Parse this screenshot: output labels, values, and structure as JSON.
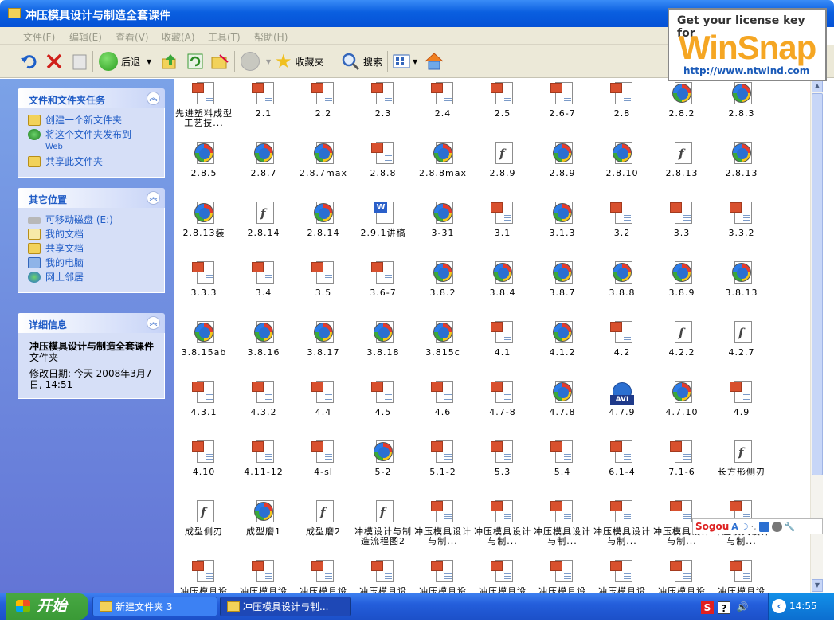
{
  "window": {
    "title": "冲压模具设计与制造全套课件"
  },
  "menu": [
    "文件(F)",
    "编辑(E)",
    "查看(V)",
    "收藏(A)",
    "工具(T)",
    "帮助(H)"
  ],
  "toolbar": {
    "back_label": "后退",
    "favorites_label": "收藏夹",
    "search_label": "搜索"
  },
  "watermark": {
    "line1": "Get your license key for",
    "brand": "WinSnap",
    "url": "http://www.ntwind.com"
  },
  "sidebar": {
    "tasks": {
      "title": "文件和文件夹任务",
      "items": [
        "创建一个新文件夹",
        "将这个文件夹发布到",
        "Web",
        "共享此文件夹"
      ]
    },
    "places": {
      "title": "其它位置",
      "items": [
        "可移动磁盘 (E:)",
        "我的文档",
        "共享文档",
        "我的电脑",
        "网上邻居"
      ]
    },
    "details": {
      "title": "详细信息",
      "name": "冲压模具设计与制造全套课件",
      "type": "文件夹",
      "modified": "修改日期: 今天 2008年3月7日, 14:51"
    }
  },
  "files": [
    {
      "name": "先进塑料成型工艺技...",
      "type": "ppt"
    },
    {
      "name": "2.1",
      "type": "ppt"
    },
    {
      "name": "2.2",
      "type": "ppt"
    },
    {
      "name": "2.3",
      "type": "ppt"
    },
    {
      "name": "2.4",
      "type": "ppt"
    },
    {
      "name": "2.5",
      "type": "ppt"
    },
    {
      "name": "2.6-7",
      "type": "ppt"
    },
    {
      "name": "2.8",
      "type": "ppt"
    },
    {
      "name": "2.8.2",
      "type": "wmv"
    },
    {
      "name": "2.8.3",
      "type": "wmv"
    },
    {
      "name": "2.8.5",
      "type": "wmv"
    },
    {
      "name": "2.8.7",
      "type": "wmv"
    },
    {
      "name": "2.8.7max",
      "type": "wmv"
    },
    {
      "name": "2.8.8",
      "type": "ppt"
    },
    {
      "name": "2.8.8max",
      "type": "wmv"
    },
    {
      "name": "2.8.9",
      "type": "swf"
    },
    {
      "name": "2.8.9",
      "type": "wmv"
    },
    {
      "name": "2.8.10",
      "type": "wmv"
    },
    {
      "name": "2.8.13",
      "type": "swf"
    },
    {
      "name": "2.8.13",
      "type": "wmv"
    },
    {
      "name": "2.8.13装",
      "type": "wmv"
    },
    {
      "name": "2.8.14",
      "type": "swf"
    },
    {
      "name": "2.8.14",
      "type": "wmv"
    },
    {
      "name": "2.9.1讲稿",
      "type": "doc"
    },
    {
      "name": "3-31",
      "type": "wmv"
    },
    {
      "name": "3.1",
      "type": "ppt"
    },
    {
      "name": "3.1.3",
      "type": "wmv"
    },
    {
      "name": "3.2",
      "type": "ppt"
    },
    {
      "name": "3.3",
      "type": "ppt"
    },
    {
      "name": "3.3.2",
      "type": "ppt"
    },
    {
      "name": "3.3.3",
      "type": "ppt"
    },
    {
      "name": "3.4",
      "type": "ppt"
    },
    {
      "name": "3.5",
      "type": "ppt"
    },
    {
      "name": "3.6-7",
      "type": "ppt"
    },
    {
      "name": "3.8.2",
      "type": "wmv"
    },
    {
      "name": "3.8.4",
      "type": "wmv"
    },
    {
      "name": "3.8.7",
      "type": "wmv"
    },
    {
      "name": "3.8.8",
      "type": "wmv"
    },
    {
      "name": "3.8.9",
      "type": "wmv"
    },
    {
      "name": "3.8.13",
      "type": "wmv"
    },
    {
      "name": "3.8.15ab",
      "type": "wmv"
    },
    {
      "name": "3.8.16",
      "type": "wmv"
    },
    {
      "name": "3.8.17",
      "type": "wmv"
    },
    {
      "name": "3.8.18",
      "type": "wmv"
    },
    {
      "name": "3.815c",
      "type": "wmv"
    },
    {
      "name": "4.1",
      "type": "ppt"
    },
    {
      "name": "4.1.2",
      "type": "wmv"
    },
    {
      "name": "4.2",
      "type": "ppt"
    },
    {
      "name": "4.2.2",
      "type": "swf"
    },
    {
      "name": "4.2.7",
      "type": "swf"
    },
    {
      "name": "4.3.1",
      "type": "ppt"
    },
    {
      "name": "4.3.2",
      "type": "ppt"
    },
    {
      "name": "4.4",
      "type": "ppt"
    },
    {
      "name": "4.5",
      "type": "ppt"
    },
    {
      "name": "4.6",
      "type": "ppt"
    },
    {
      "name": "4.7-8",
      "type": "ppt"
    },
    {
      "name": "4.7.8",
      "type": "wmv"
    },
    {
      "name": "4.7.9",
      "type": "avi"
    },
    {
      "name": "4.7.10",
      "type": "wmv"
    },
    {
      "name": "4.9",
      "type": "ppt"
    },
    {
      "name": "4.10",
      "type": "ppt"
    },
    {
      "name": "4.11-12",
      "type": "ppt"
    },
    {
      "name": "4-sl",
      "type": "ppt"
    },
    {
      "name": "5-2",
      "type": "wmv"
    },
    {
      "name": "5.1-2",
      "type": "ppt"
    },
    {
      "name": "5.3",
      "type": "ppt"
    },
    {
      "name": "5.4",
      "type": "ppt"
    },
    {
      "name": "6.1-4",
      "type": "ppt"
    },
    {
      "name": "7.1-6",
      "type": "ppt"
    },
    {
      "name": "长方形侧刃",
      "type": "swf"
    },
    {
      "name": "成型侧刃",
      "type": "swf"
    },
    {
      "name": "成型磨1",
      "type": "wmv"
    },
    {
      "name": "成型磨2",
      "type": "swf"
    },
    {
      "name": "冲模设计与制造流程图2",
      "type": "swf"
    },
    {
      "name": "冲压模具设计与制...",
      "type": "ppt"
    },
    {
      "name": "冲压模具设计与制...",
      "type": "ppt"
    },
    {
      "name": "冲压模具设计与制...",
      "type": "ppt"
    },
    {
      "name": "冲压模具设计与制...",
      "type": "ppt"
    },
    {
      "name": "冲压模具设计与制...",
      "type": "ppt"
    },
    {
      "name": "冲压模具设计与制...",
      "type": "ppt"
    },
    {
      "name": "冲压模具设",
      "type": "ppt"
    },
    {
      "name": "冲压模具设",
      "type": "ppt"
    },
    {
      "name": "冲压模具设",
      "type": "ppt"
    },
    {
      "name": "冲压模具设",
      "type": "ppt"
    },
    {
      "name": "冲压模具设",
      "type": "ppt"
    },
    {
      "name": "冲压模具设",
      "type": "ppt"
    },
    {
      "name": "冲压模具设",
      "type": "ppt"
    },
    {
      "name": "冲压模具设",
      "type": "ppt"
    },
    {
      "name": "冲压模具设",
      "type": "ppt"
    },
    {
      "name": "冲压模具设",
      "type": "ppt"
    }
  ],
  "sogou": {
    "label": "Sogou"
  },
  "taskbar": {
    "start_label": "开始",
    "tasks": [
      "新建文件夹 3",
      "冲压模具设计与制..."
    ],
    "clock": "14:55"
  },
  "colors": {
    "titlebar": "#0a5fe0",
    "sidebar_link": "#215dc6",
    "start_green": "#3a9a36",
    "watermark_orange": "#f5a623"
  }
}
